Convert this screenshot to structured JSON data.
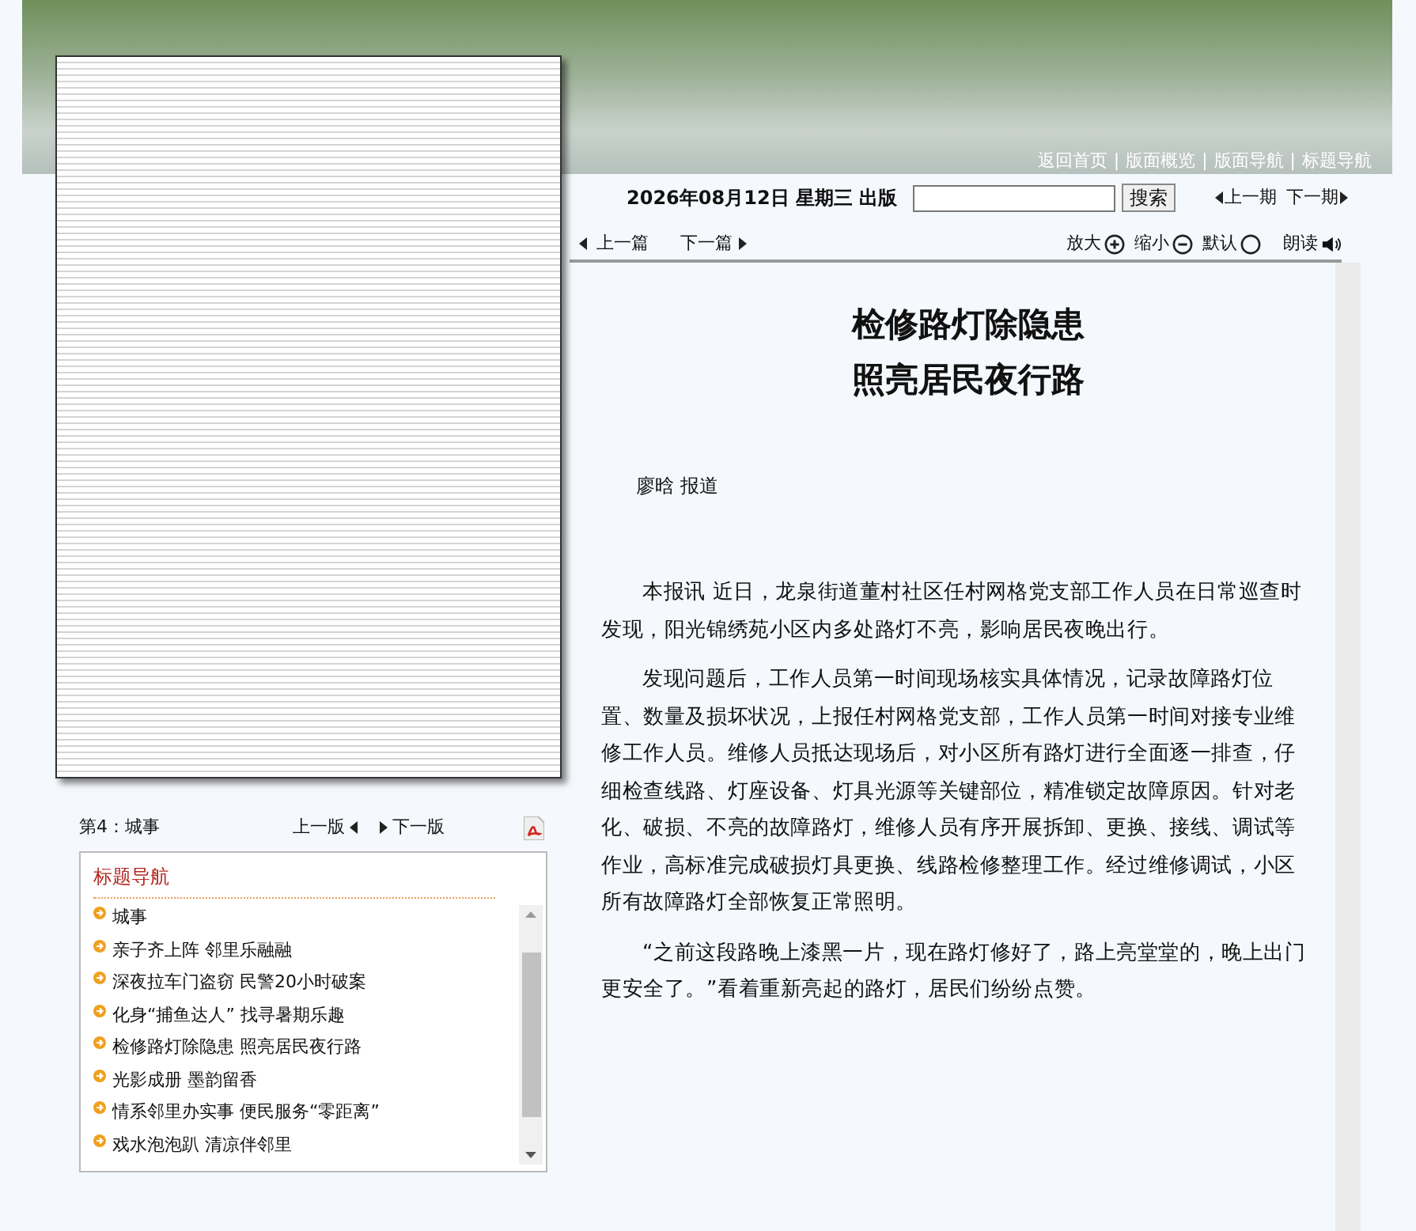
{
  "banner": {
    "links": [
      "返回首页",
      "版面概览",
      "版面导航",
      "标题导航"
    ],
    "separator": "|"
  },
  "edition": {
    "date": "2026年08月12日 星期三 出版",
    "search_button": "搜索",
    "prev_issue": "上一期",
    "next_issue": "下一期"
  },
  "article_nav": {
    "prev": "上一篇",
    "next": "下一篇",
    "tools": [
      {
        "label": "放大",
        "kind": "zoom-in"
      },
      {
        "label": "缩小",
        "kind": "zoom-out"
      },
      {
        "label": "默认",
        "kind": "reset"
      },
      {
        "label": "朗读",
        "kind": "speak"
      }
    ]
  },
  "article": {
    "title_lines": [
      "检修路灯除隐患",
      "照亮居民夜行路"
    ],
    "byline": "廖晗 报道",
    "paragraphs": [
      "本报讯 近日，龙泉街道董村社区任村网格党支部工作人员在日常巡查时发现，阳光锦绣苑小区内多处路灯不亮，影响居民夜晚出行。",
      "发现问题后，工作人员第一时间现场核实具体情况，记录故障路灯位置、数量及损坏状况，上报任村网格党支部，工作人员第一时间对接专业维修工作人员。维修人员抵达现场后，对小区所有路灯进行全面逐一排查，仔细检查线路、灯座设备、灯具光源等关键部位，精准锁定故障原因。针对老化、破损、不亮的故障路灯，维修人员有序开展拆卸、更换、接线、调试等作业，高标准完成破损灯具更换、线路检修整理工作。经过维修调试，小区所有故障路灯全部恢复正常照明。",
      "“之前这段路晚上漆黑一片，现在路灯修好了，路上亮堂堂的，晚上出门更安全了。”看着重新亮起的路灯，居民们纷纷点赞。"
    ]
  },
  "page_nav": {
    "page": "第4：城事",
    "prev": "上一版",
    "next": "下一版"
  },
  "headline_nav": {
    "title": "标题导航",
    "items": [
      "城事",
      "亲子齐上阵 邻里乐融融",
      "深夜拉车门盗窃 民警20小时破案",
      "化身“捕鱼达人” 找寻暑期乐趣",
      "检修路灯除隐患 照亮居民夜行路",
      "光影成册 墨韵留香",
      "情系邻里办实事 便民服务“零距离”",
      "戏水泡泡趴 清凉伴邻里"
    ]
  }
}
